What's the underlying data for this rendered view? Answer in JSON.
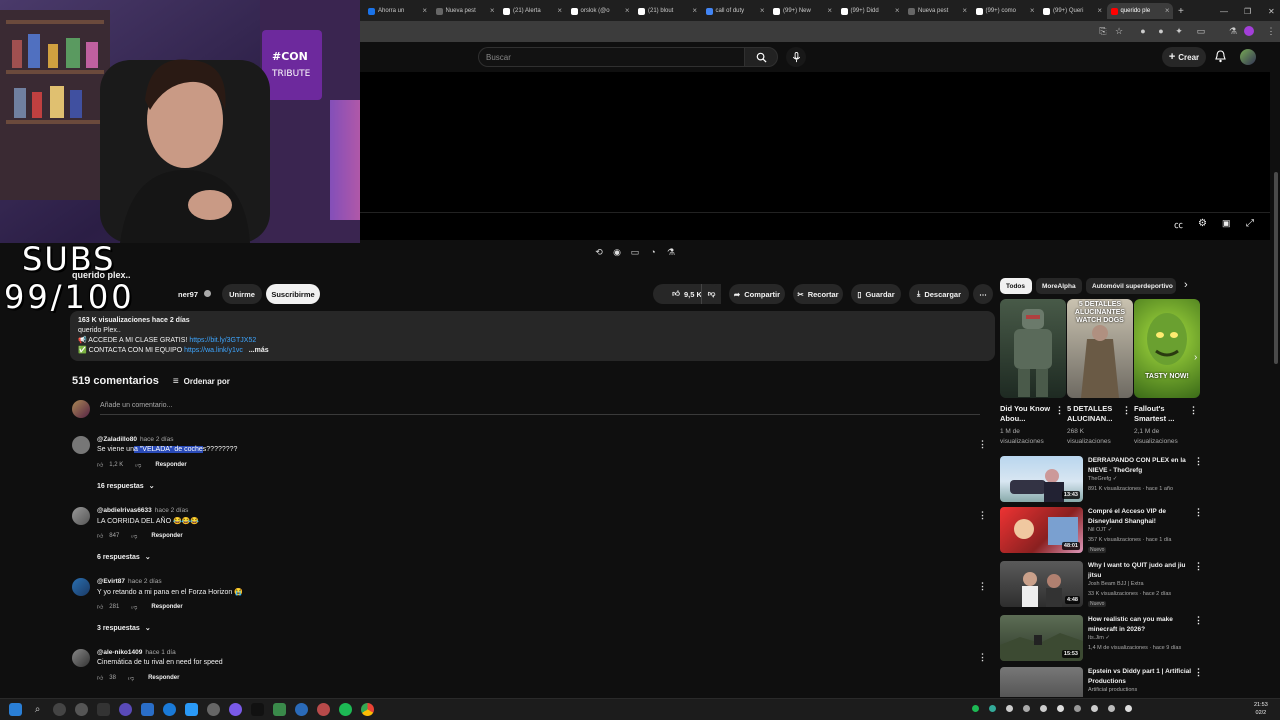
{
  "browser": {
    "tabs": [
      {
        "label": "Ahorra un",
        "color": "#1a73e8"
      },
      {
        "label": "Nueva pest",
        "color": "#666666"
      },
      {
        "label": "(21) Alerta",
        "color": "#ffffff"
      },
      {
        "label": "orslok (@o",
        "color": "#ffffff"
      },
      {
        "label": "(21) blout",
        "color": "#ffffff"
      },
      {
        "label": "call of duty",
        "color": "#4285f4"
      },
      {
        "label": "(99+) New",
        "color": "#ffffff"
      },
      {
        "label": "(99+) Didd",
        "color": "#ffffff"
      },
      {
        "label": "Nueva pest",
        "color": "#666666"
      },
      {
        "label": "(99+) como",
        "color": "#ffffff"
      },
      {
        "label": "(99+) Queri",
        "color": "#ffffff"
      },
      {
        "label": "querido ple",
        "color": "#ff0000"
      }
    ]
  },
  "header": {
    "search_placeholder": "Buscar",
    "create_label": "Crear"
  },
  "overlay": {
    "subs_label": "SUBS",
    "subs_count": "99/100"
  },
  "video": {
    "title": "querido plex..",
    "channel": "ner97",
    "join_label": "Unirme",
    "subscribe_label": "Suscribirme",
    "likes": "9,5 K",
    "share_label": "Compartir",
    "clip_label": "Recortar",
    "save_label": "Guardar",
    "download_label": "Descargar"
  },
  "description": {
    "stats": "163 K visualizaciones  hace 2 días",
    "line1": "querido Plex..",
    "line2_text": "ACCEDE A MI CLASE GRATIS!",
    "line2_link": "https://bit.ly/3GTJX52",
    "line3_text": "CONTACTA CON MI EQUIPO",
    "line3_link": "https://wa.link/y1vc",
    "more": "...más"
  },
  "comments": {
    "count_label": "519 comentarios",
    "sort_label": "Ordenar por",
    "add_placeholder": "Añade un comentario...",
    "items": [
      {
        "author": "@Zaladillo80",
        "when": "hace 2 días",
        "text_before": "Se viene un",
        "text_highlight": "a \"VELADA\" de coche",
        "text_after": "s????????",
        "likes": "1,2 K",
        "reply": "Responder",
        "replies": "16 respuestas"
      },
      {
        "author": "@abdielrivas6633",
        "when": "hace 2 días",
        "text": "LA CORRIDA DEL AÑO 😂😂😂",
        "likes": "847",
        "reply": "Responder",
        "replies": "6 respuestas"
      },
      {
        "author": "@Evirt87",
        "when": "hace 2 días",
        "text": "Y yo retando a mi pana en el Forza Horizon 😭",
        "likes": "281",
        "reply": "Responder",
        "replies": "3 respuestas"
      },
      {
        "author": "@ale-niko1409",
        "when": "hace 1 día",
        "text": "Cinemática de tu rival en need for speed",
        "likes": "38",
        "reply": "Responder"
      }
    ]
  },
  "sidebar": {
    "chips": [
      "Todos",
      "MoreAlpha",
      "Automóvil superdeportivo"
    ],
    "shorts": [
      {
        "title": "Did You Know Abou...",
        "views": "1 M de visualizaciones",
        "thumb_text": ""
      },
      {
        "title": "5 DETALLES ALUCINAN...",
        "views": "268 K visualizaciones",
        "thumb_text": "5 DETALLES ALUCINANTES WATCH DOGS"
      },
      {
        "title": "Fallout's Smartest ...",
        "views": "2,1 M de visualizaciones",
        "thumb_text": "TASTY NOW!"
      }
    ],
    "recommended": [
      {
        "title": "DERRAPANDO CON PLEX en la NIEVE - TheGrefg",
        "channel": "TheGrefg ✓",
        "stats": "891 K visualizaciones · hace 1 año",
        "duration": "13:43",
        "badge": ""
      },
      {
        "title": "Compré el Acceso VIP de Disneyland Shanghai!",
        "channel": "Nil OJT ✓",
        "stats": "357 K visualizaciones · hace 1 día",
        "duration": "48:01",
        "badge": "Nuevo"
      },
      {
        "title": "Why I want to QUIT judo and jiu jitsu",
        "channel": "Josh Beam BJJ | Extra",
        "stats": "33 K visualizaciones · hace 2 días",
        "duration": "4:48",
        "badge": "Nuevo"
      },
      {
        "title": "How realistic can you make minecraft in 2026?",
        "channel": "Its.Jim ✓",
        "stats": "1,4 M de visualizaciones · hace 9 días",
        "duration": "15:53",
        "badge": ""
      },
      {
        "title": "Epstein vs Diddy part 1 | Artificial Productions",
        "channel": "Artificial productions",
        "stats": "",
        "duration": "",
        "badge": ""
      }
    ]
  },
  "taskbar": {
    "time": "21:53",
    "date": "02/2"
  }
}
